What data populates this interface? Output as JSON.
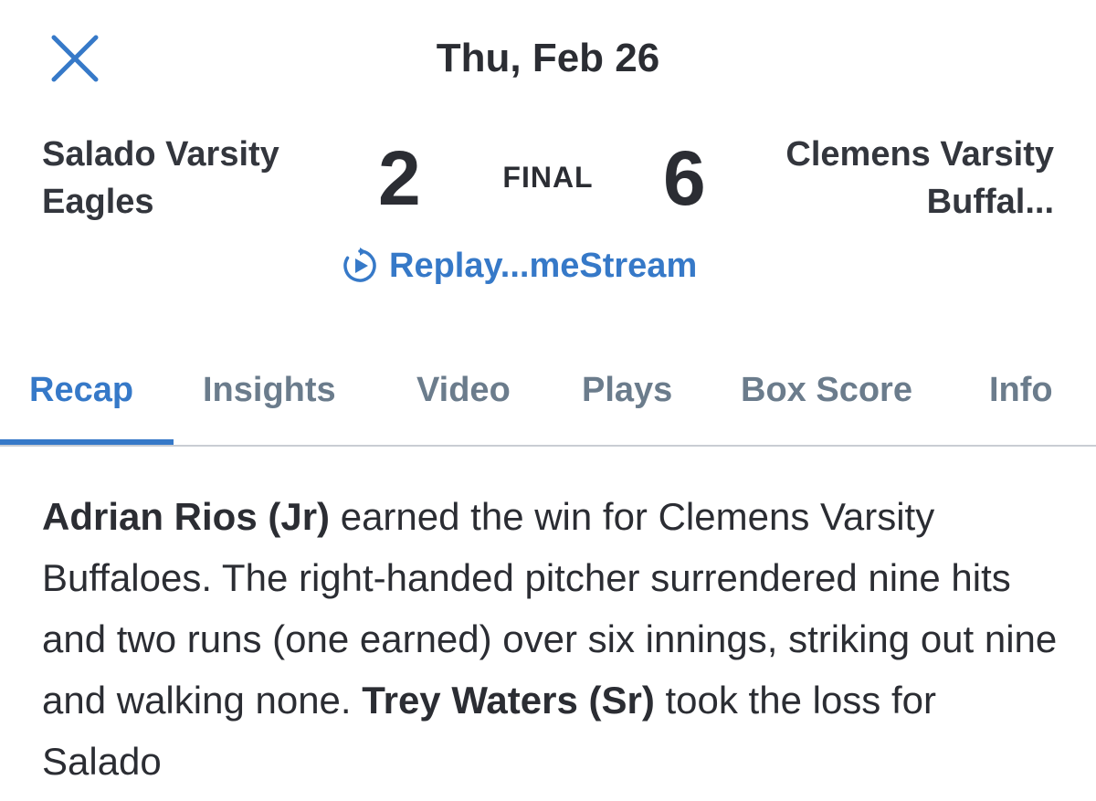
{
  "header": {
    "close_icon": "close-icon",
    "date": "Thu, Feb 26"
  },
  "game": {
    "home_team": "Salado Varsity Eagles",
    "home_score": "2",
    "status": "FINAL",
    "away_score": "6",
    "away_team": "Clemens Varsity Buffal..."
  },
  "replay": {
    "icon": "replay-play-icon",
    "label": "Replay...meStream"
  },
  "tabs": [
    {
      "label": "Recap",
      "active": true
    },
    {
      "label": "Insights",
      "active": false
    },
    {
      "label": "Video",
      "active": false
    },
    {
      "label": "Plays",
      "active": false
    },
    {
      "label": "Box Score",
      "active": false
    },
    {
      "label": "Info",
      "active": false
    }
  ],
  "recap": {
    "player1": "Adrian Rios (Jr)",
    "text1": " earned the win for Clemens Varsity Buffaloes. The right-handed pitcher surrendered nine hits and two runs (one earned) over six innings, striking out nine and walking none. ",
    "player2": "Trey Waters (Sr)",
    "text2": " took the loss for Salado"
  },
  "colors": {
    "accent": "#3679c8",
    "text": "#2b2d33",
    "tab_inactive": "#6b7c8c",
    "divider": "#c9cdd3"
  }
}
